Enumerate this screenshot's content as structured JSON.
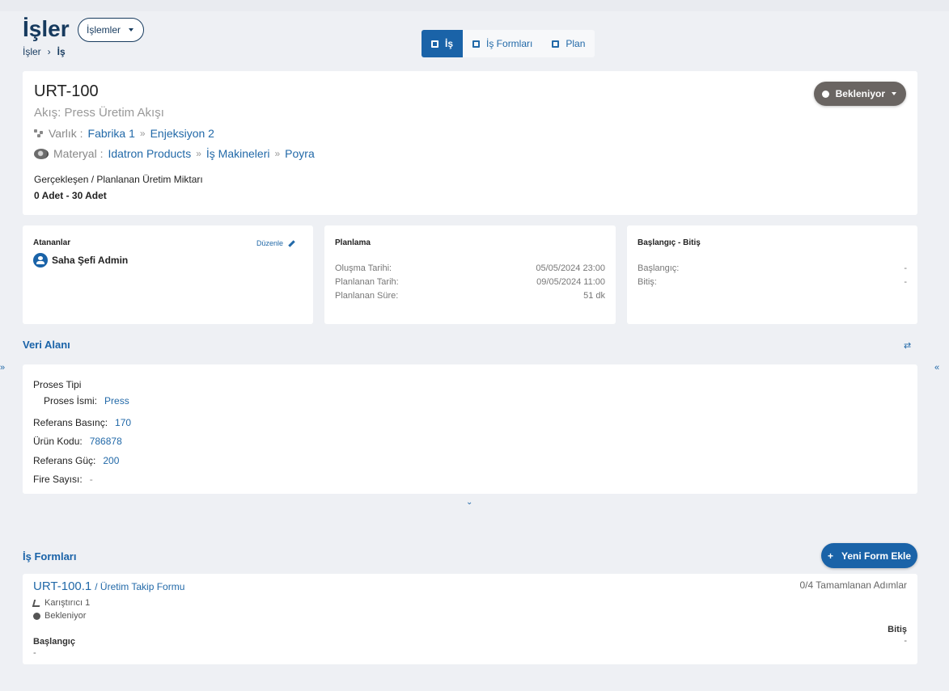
{
  "header": {
    "title": "İşler",
    "operations_label": "İşlemler",
    "breadcrumb": [
      "İşler",
      "İş"
    ]
  },
  "view_tabs": [
    {
      "label": "İş",
      "icon": "calendar-icon",
      "active": true
    },
    {
      "label": "İş Formları",
      "icon": "save-icon",
      "active": false
    },
    {
      "label": "Plan",
      "icon": "board-icon",
      "active": false
    }
  ],
  "job": {
    "code": "URT-100",
    "flow": "Akış: Press Üretim Akışı",
    "varlik_label": "Varlık :",
    "varlik_path": [
      "Fabrika 1",
      "Enjeksiyon 2"
    ],
    "materyal_label": "Materyal :",
    "materyal_path": [
      "Idatron Products",
      "İş Makineleri",
      "Poyra"
    ],
    "qty_label": "Gerçekleşen / Planlanan Üretim Miktarı",
    "qty_value": "0 Adet - 30 Adet",
    "status": "Bekleniyor",
    "status_color": "#6a6562"
  },
  "assignees": {
    "title": "Atananlar",
    "edit_label": "Düzenle",
    "user": "Saha Şefi Admin"
  },
  "planning": {
    "title": "Planlama",
    "rows": [
      {
        "label": "Oluşma Tarihi:",
        "value": "05/05/2024 23:00"
      },
      {
        "label": "Planlanan Tarih:",
        "value": "09/05/2024 11:00"
      },
      {
        "label": "Planlanan Süre:",
        "value": "51 dk"
      }
    ]
  },
  "start_end": {
    "title": "Başlangıç - Bitiş",
    "rows": [
      {
        "label": "Başlangıç:",
        "value": "-"
      },
      {
        "label": "Bitiş:",
        "value": "-"
      }
    ]
  },
  "data_area": {
    "title": "Veri Alanı",
    "proses_tipi": "Proses Tipi",
    "proses_ismi_label": "Proses İsmi:",
    "proses_ismi_value": "Press",
    "fields": [
      {
        "label": "Referans Basınç:",
        "value": "170"
      },
      {
        "label": "Ürün Kodu:",
        "value": "786878"
      },
      {
        "label": "Referans Güç:",
        "value": "200"
      },
      {
        "label": "Fire Sayısı:",
        "value": "-"
      }
    ]
  },
  "forms": {
    "title": "İş Formları",
    "new_button": "Yeni Form Ekle",
    "items": [
      {
        "code": "URT-100.1",
        "type": "/ Üretim Takip Formu",
        "steps": "0/4 Tamamlanan Adımlar",
        "machine": "Karıştırıcı 1",
        "status": "Bekleniyor",
        "start_label": "Başlangıç",
        "start_value": "-",
        "end_label": "Bitiş",
        "end_value": "-"
      }
    ]
  },
  "colors": {
    "accent": "#1a63a8",
    "title": "#163a5e"
  }
}
